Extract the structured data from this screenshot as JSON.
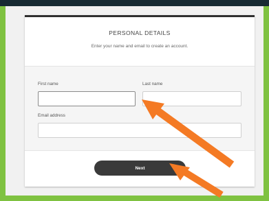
{
  "form": {
    "title": "PERSONAL DETAILS",
    "subtitle": "Enter your name and email to create an account.",
    "first_name": {
      "label": "First name",
      "value": "",
      "placeholder": ""
    },
    "last_name": {
      "label": "Last name",
      "value": "",
      "placeholder": ""
    },
    "email": {
      "label": "Email address",
      "value": "",
      "placeholder": ""
    },
    "next_label": "Next"
  },
  "colors": {
    "page_border": "#7fc241",
    "top_bar": "#172a33",
    "card_top_border": "#2f2f2f",
    "button": "#3a3a3a",
    "annotation_arrow": "#f47a24"
  },
  "annotations": {
    "arrows": [
      "arrow-to-last-name-field",
      "arrow-to-next-button"
    ]
  }
}
